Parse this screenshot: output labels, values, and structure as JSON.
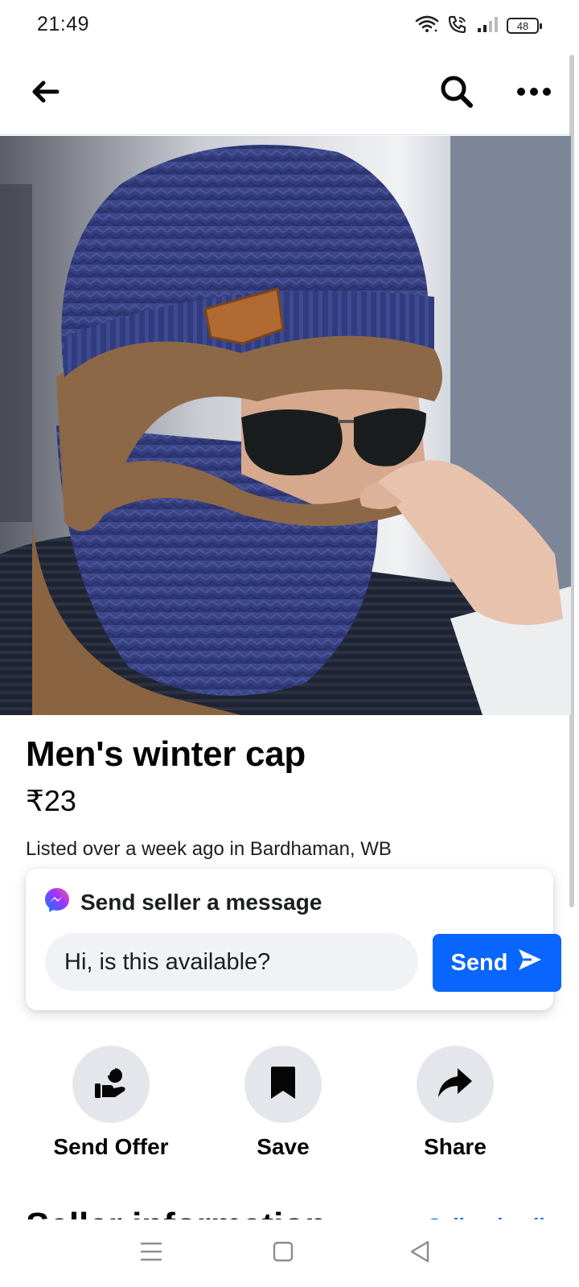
{
  "status_bar": {
    "time": "21:49",
    "battery": "48",
    "icons": [
      "wifi-icon",
      "wifi-calling-icon",
      "signal-icon",
      "battery-icon"
    ]
  },
  "nav": {
    "icons": [
      "back-arrow-icon",
      "search-icon",
      "more-icon"
    ]
  },
  "listing": {
    "image_alt": "Product photo: person wearing a navy knitted winter cap with brown fleece neck warmer and sunglasses",
    "title": "Men's winter cap",
    "price": "₹23",
    "listed": "Listed over a week ago in Bardhaman, WB"
  },
  "message_card": {
    "title": "Send seller a message",
    "input_value": "Hi, is this available?",
    "send_label": "Send",
    "icon": "messenger-icon"
  },
  "actions": [
    {
      "label": "Send Offer",
      "icon": "offer-hand-icon"
    },
    {
      "label": "Save",
      "icon": "bookmark-icon"
    },
    {
      "label": "Share",
      "icon": "share-arrow-icon"
    }
  ],
  "seller_section": {
    "title": "Seller information",
    "link": "Seller details"
  },
  "system_nav": {
    "icons": [
      "menu-icon",
      "home-icon",
      "back-triangle-icon"
    ]
  },
  "colors": {
    "accent": "#0866ff",
    "action_bg": "#e4e6eb",
    "input_bg": "#f0f2f5"
  }
}
